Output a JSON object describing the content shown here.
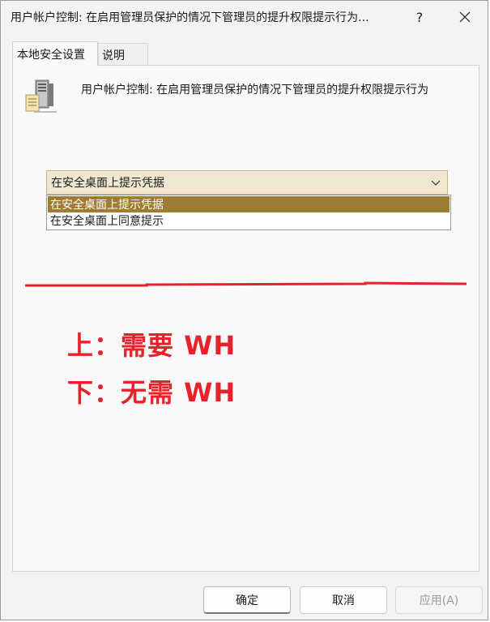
{
  "window": {
    "title": "用户帐户控制: 在启用管理员保护的情况下管理员的提升权限提示行为...",
    "help_label": "?",
    "close_icon": "close-icon"
  },
  "tabs": [
    {
      "label": "本地安全设置",
      "active": true
    },
    {
      "label": "说明",
      "active": false
    }
  ],
  "policy": {
    "icon": "server-policy-icon",
    "title": "用户帐户控制: 在启用管理员保护的情况下管理员的提升权限提示行为"
  },
  "dropdown": {
    "selected": "在安全桌面上提示凭据",
    "options": [
      "在安全桌面上提示凭据",
      "在安全桌面上同意提示"
    ]
  },
  "annotations": {
    "line_1": "上：需要 WH",
    "line_2": "下：无需 WH",
    "color": "#e8212a"
  },
  "buttons": {
    "ok": "确定",
    "cancel": "取消",
    "apply": "应用(A)"
  },
  "colors": {
    "dropdown_bg": "#f1e6cf",
    "option_selected_bg": "#a07c33",
    "annotation_red": "#e8212a"
  }
}
